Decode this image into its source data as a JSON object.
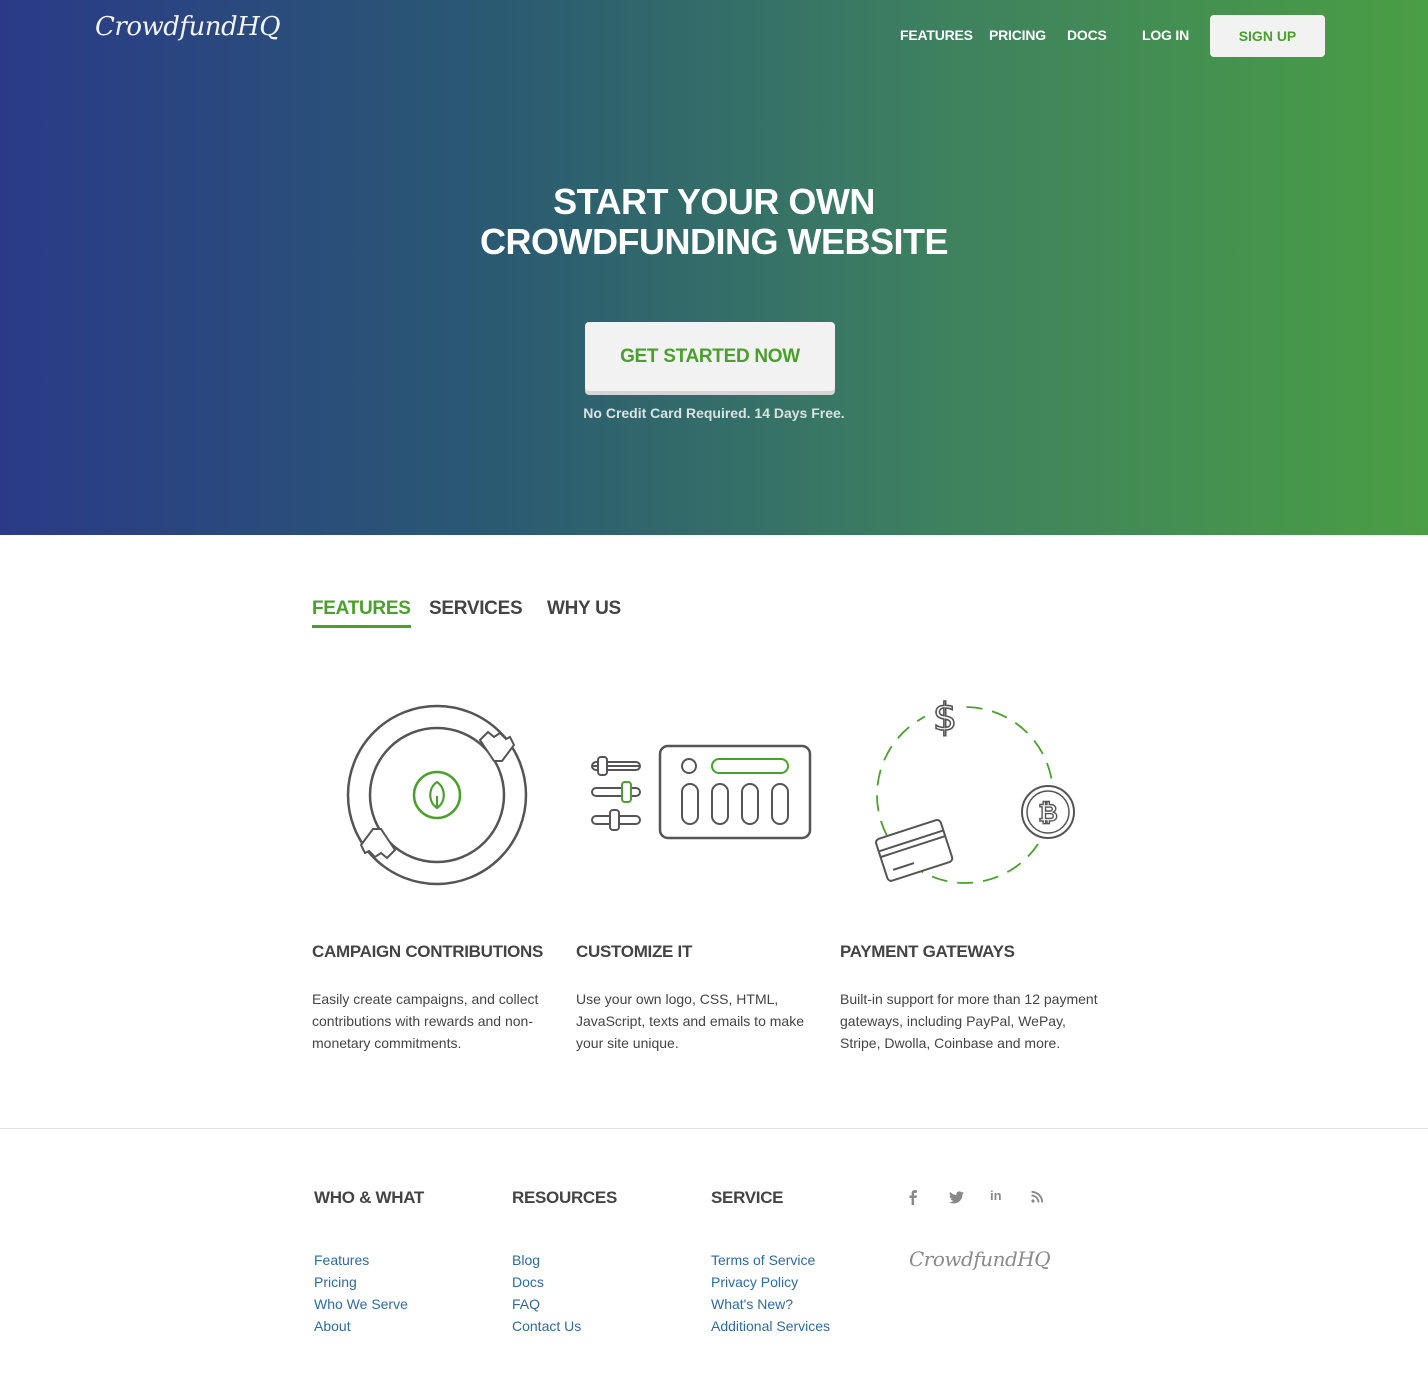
{
  "brand": {
    "logo_text": "CrowdfundHQ"
  },
  "nav": {
    "features": "FEATURES",
    "pricing": "PRICING",
    "docs": "DOCS",
    "login": "LOG IN",
    "signup": "SIGN UP"
  },
  "hero": {
    "headline_part1": "START ",
    "headline_part2": "YOUR OWN",
    "headline_line2": "CROWDFUNDING WEBSITE",
    "cta_label": "GET STARTED NOW",
    "cta_note": "No Credit Card Required. 14 Days Free."
  },
  "tabs": [
    {
      "label": "FEATURES",
      "active": true
    },
    {
      "label": "SERVICES",
      "active": false
    },
    {
      "label": "WHY US",
      "active": false
    }
  ],
  "features": [
    {
      "title": "CAMPAIGN CONTRIBUTIONS",
      "description": "Easily create campaigns, and collect contributions with rewards and non-monetary commitments."
    },
    {
      "title": "CUSTOMIZE IT",
      "description": "Use your own logo, CSS, HTML, JavaScript, texts and emails to make your site unique."
    },
    {
      "title": "PAYMENT GATEWAYS",
      "description": "Built-in support for more than 12 payment gateways, including PayPal, WePay, Stripe, Dwolla, Coinbase and more."
    }
  ],
  "footer": {
    "columns": [
      {
        "title": "WHO & WHAT",
        "links": [
          "Features",
          "Pricing",
          "Who We Serve",
          "About"
        ]
      },
      {
        "title": "RESOURCES",
        "links": [
          "Blog",
          "Docs",
          "FAQ",
          "Contact Us"
        ]
      },
      {
        "title": "SERVICE",
        "links": [
          "Terms of Service",
          "Privacy Policy",
          "What's New?",
          "Additional Services"
        ]
      }
    ],
    "social": [
      {
        "icon": "facebook-icon",
        "glyph": "f"
      },
      {
        "icon": "twitter-icon",
        "glyph": "t"
      },
      {
        "icon": "linkedin-icon",
        "glyph": "in"
      },
      {
        "icon": "rss-icon",
        "glyph": "≋"
      }
    ],
    "logo_text": "CrowdfundHQ"
  },
  "colors": {
    "accent_green": "#4aa02c",
    "link_blue": "#2d6aa6",
    "hero_gradient_start": "#2a3a88",
    "hero_gradient_end": "#4a9e44"
  }
}
